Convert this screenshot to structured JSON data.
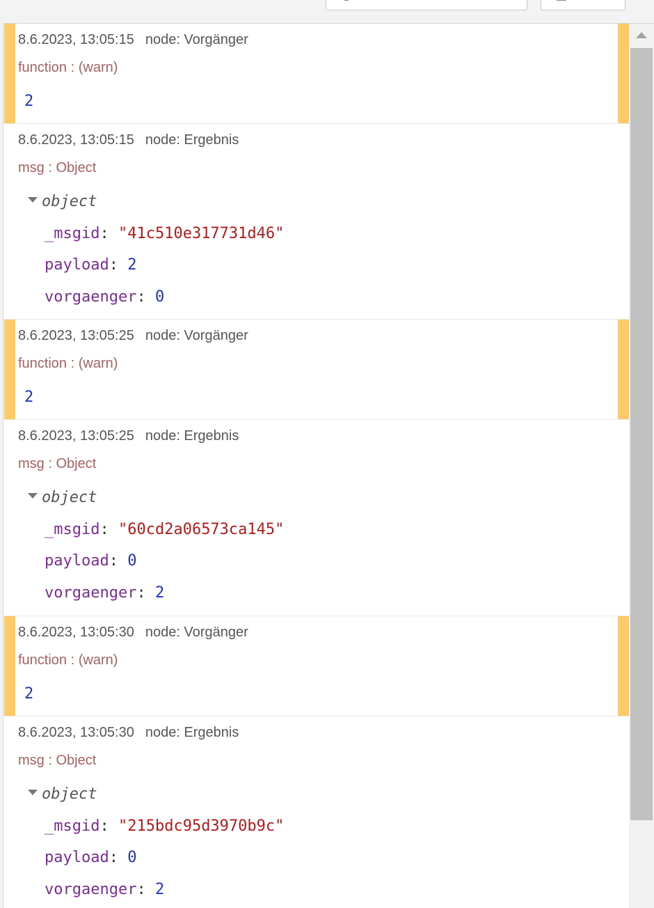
{
  "messages": [
    {
      "time": "8.6.2023, 13:05:15",
      "node": "node: Vorgänger",
      "topic": "function : (warn)",
      "value": "2"
    },
    {
      "time": "8.6.2023, 13:05:15",
      "node": "node: Ergebnis",
      "topic": "msg : Object",
      "object_label": "object",
      "msgid": "\"41c510e317731d46\"",
      "payload": "2",
      "vorgaenger": "0"
    },
    {
      "time": "8.6.2023, 13:05:25",
      "node": "node: Vorgänger",
      "topic": "function : (warn)",
      "value": "2"
    },
    {
      "time": "8.6.2023, 13:05:25",
      "node": "node: Ergebnis",
      "topic": "msg : Object",
      "object_label": "object",
      "msgid": "\"60cd2a06573ca145\"",
      "payload": "0",
      "vorgaenger": "2"
    },
    {
      "time": "8.6.2023, 13:05:30",
      "node": "node: Vorgänger",
      "topic": "function : (warn)",
      "value": "2"
    },
    {
      "time": "8.6.2023, 13:05:30",
      "node": "node: Ergebnis",
      "topic": "msg : Object",
      "object_label": "object",
      "msgid": "\"215bdc95d3970b9c\"",
      "payload": "0",
      "vorgaenger": "2"
    }
  ],
  "keys": {
    "msgid": "_msgid",
    "payload": "payload",
    "vorgaenger": "vorgaenger"
  },
  "icons": {
    "collapse": "caret-down-icon",
    "scroll_up": "scroll-up-arrow-icon"
  },
  "colors": {
    "warn_marker": "#fdca6a",
    "string": "#b31b1b",
    "number": "#2233bb",
    "key": "#792e90",
    "topic": "#a66060"
  }
}
